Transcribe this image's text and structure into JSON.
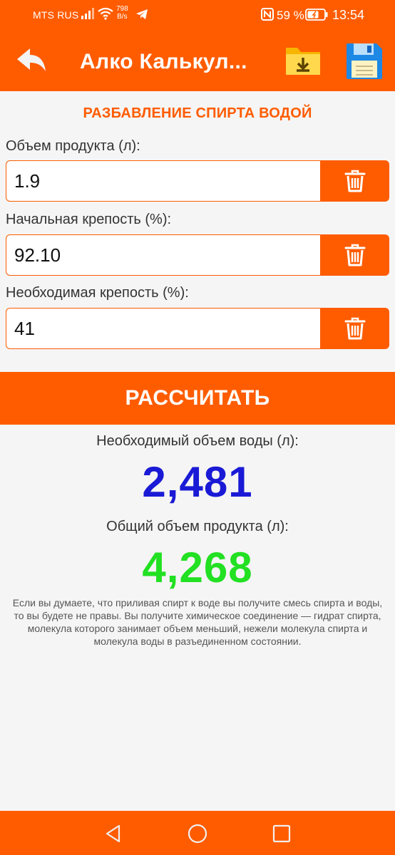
{
  "status_bar": {
    "carrier": "MTS RUS",
    "speed_value": "798",
    "speed_unit": "B/s",
    "battery": "59 %",
    "time": "13:54"
  },
  "app_bar": {
    "title": "Алко Калькул..."
  },
  "section_title": "РАЗБАВЛЕНИЕ СПИРТА ВОДОЙ",
  "fields": [
    {
      "label": "Объем продукта (л):",
      "value": "1.9"
    },
    {
      "label": "Начальная крепость (%):",
      "value": "92.10"
    },
    {
      "label": "Необходимая крепость (%):",
      "value": "41"
    }
  ],
  "calculate_label": "РАССЧИТАТЬ",
  "results": {
    "water_label": "Необходимый объем воды (л):",
    "water_value": "2,481",
    "total_label": "Общий объем продукта (л):",
    "total_value": "4,268"
  },
  "info_text": "Если вы думаете, что приливая спирт к воде вы получите смесь спирта и воды, то вы будете не правы. Вы получите химическое соединение — гидрат спирта, молекула которого занимает объем меньший, нежели молекула спирта и молекула воды в разъединенном состоянии.",
  "colors": {
    "accent": "#ff5c00",
    "water_value": "#1a1ad6",
    "total_value": "#22e022"
  },
  "icons": {
    "back": "back-arrow-icon",
    "folder": "folder-download-icon",
    "save": "floppy-disk-icon",
    "trash": "trash-icon",
    "nav_back": "triangle-back-icon",
    "nav_home": "circle-home-icon",
    "nav_recent": "square-recent-icon"
  }
}
